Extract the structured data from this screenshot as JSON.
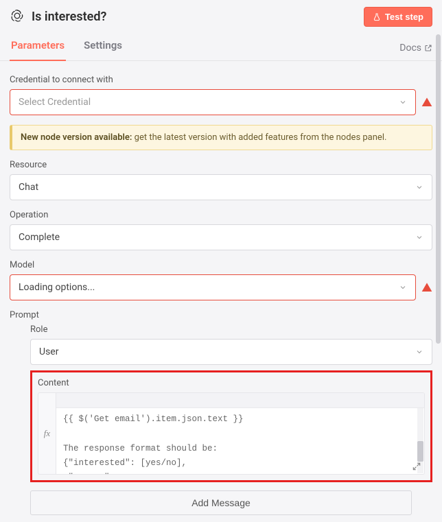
{
  "header": {
    "title": "Is interested?",
    "test_button": "Test step"
  },
  "tabs": {
    "parameters": "Parameters",
    "settings": "Settings",
    "docs": "Docs"
  },
  "fields": {
    "credential": {
      "label": "Credential to connect with",
      "placeholder": "Select Credential"
    },
    "banner": {
      "strong": "New node version available:",
      "text": " get the latest version with added features from the nodes panel."
    },
    "resource": {
      "label": "Resource",
      "value": "Chat"
    },
    "operation": {
      "label": "Operation",
      "value": "Complete"
    },
    "model": {
      "label": "Model",
      "value": "Loading options..."
    },
    "prompt": {
      "label": "Prompt",
      "role_label": "Role",
      "role_value": "User",
      "content_label": "Content",
      "content_text": "{{ $('Get email').item.json.text }}\n\nThe response format should be:\n{\"interested\": [yes/no],\n \"reason\": reason\n}",
      "fx": "fx"
    },
    "add_message": "Add Message"
  }
}
